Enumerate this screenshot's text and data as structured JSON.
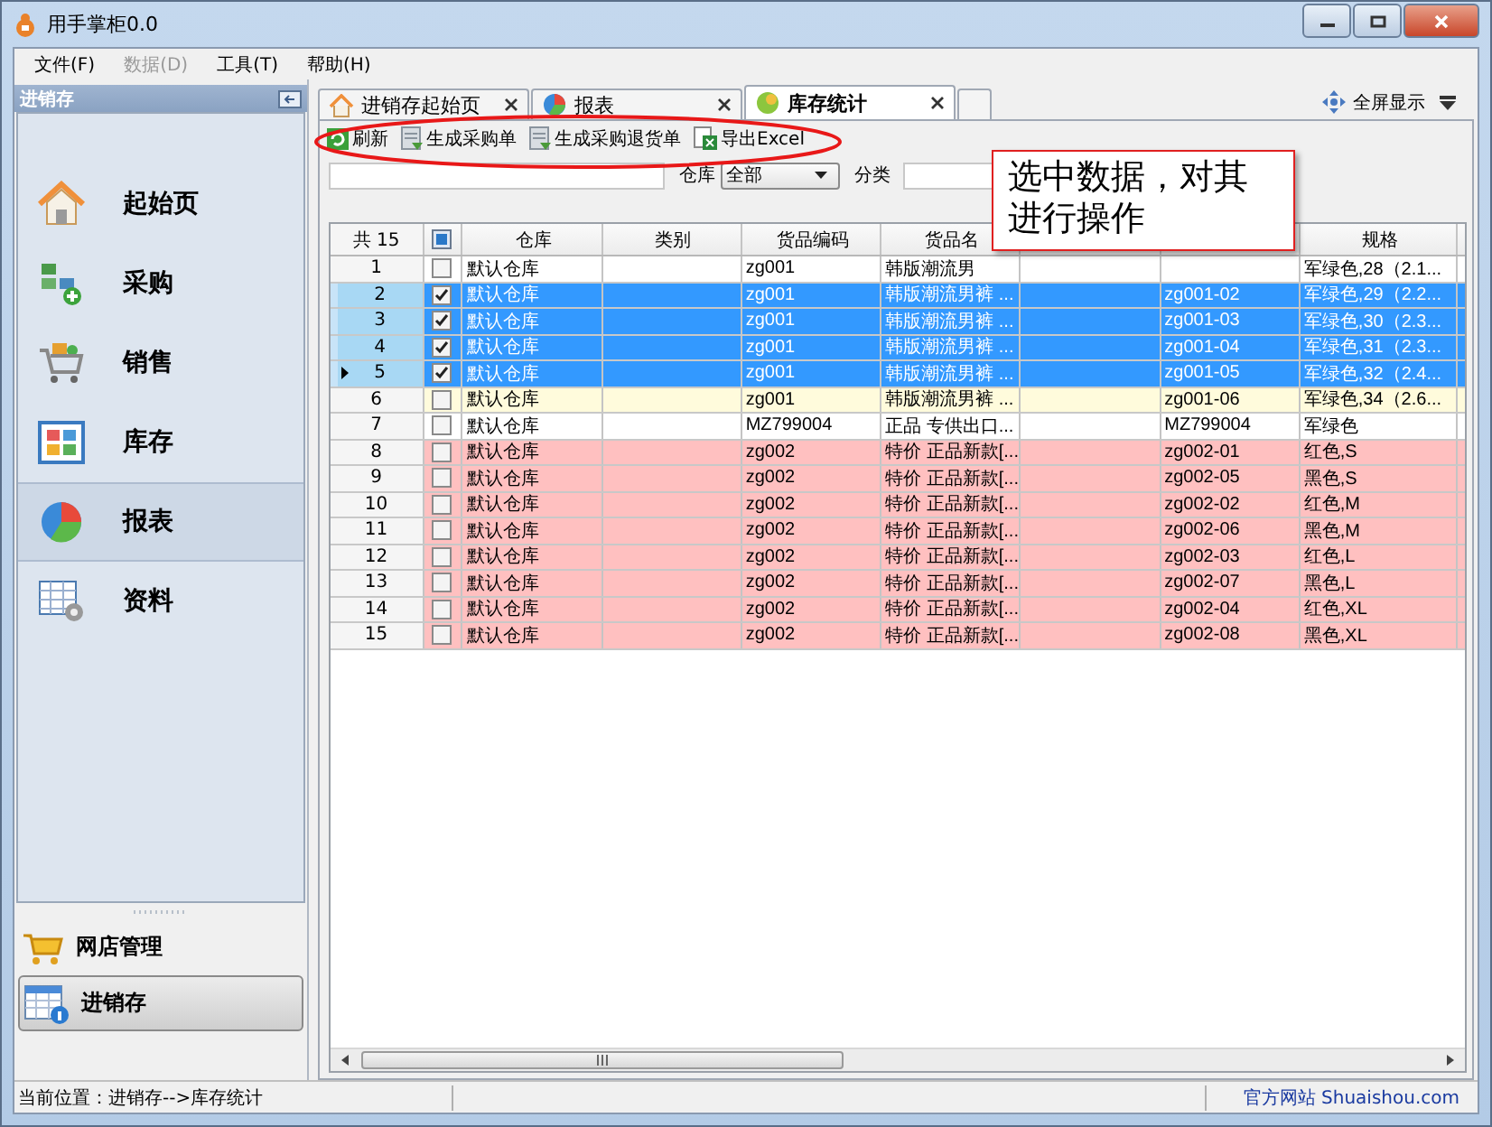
{
  "window": {
    "title": "用手掌柜0.0"
  },
  "menu": [
    {
      "label": "文件(F)",
      "disabled": false
    },
    {
      "label": "数据(D)",
      "disabled": true
    },
    {
      "label": "工具(T)",
      "disabled": false
    },
    {
      "label": "帮助(H)",
      "disabled": false
    }
  ],
  "sidebar": {
    "title": "进销存",
    "items": [
      {
        "label": "起始页",
        "selected": false
      },
      {
        "label": "采购",
        "selected": false
      },
      {
        "label": "销售",
        "selected": false
      },
      {
        "label": "库存",
        "selected": false
      },
      {
        "label": "报表",
        "selected": true
      },
      {
        "label": "资料",
        "selected": false
      }
    ],
    "modules": [
      {
        "label": "网店管理",
        "selected": false
      },
      {
        "label": "进销存",
        "selected": true
      }
    ]
  },
  "tabs": [
    {
      "label": "进销存起始页",
      "selected": false
    },
    {
      "label": "报表",
      "selected": false
    },
    {
      "label": "库存统计",
      "selected": true
    }
  ],
  "fullscreen": "全屏显示",
  "toolbar": [
    "刷新",
    "生成采购单",
    "生成采购退货单",
    "导出Excel"
  ],
  "filter": {
    "warehouse_label": "仓库",
    "warehouse_value": "全部",
    "category_label": "分类"
  },
  "callout": "选中数据，对其进行操作",
  "table": {
    "count": "共 15",
    "select_all_partial": true,
    "columns": [
      "仓库",
      "类别",
      "货品编码",
      "货品名",
      "规格"
    ],
    "rows": [
      {
        "no": "1",
        "checked": false,
        "selected": false,
        "current": false,
        "color": "#ffffff",
        "cells": [
          "默认仓库",
          "",
          "zg001",
          "韩版潮流男",
          "",
          "",
          "军绿色,28（2.1..."
        ]
      },
      {
        "no": "2",
        "checked": true,
        "selected": true,
        "current": false,
        "cells": [
          "默认仓库",
          "",
          "zg001",
          "韩版潮流男裤 ...",
          "",
          "zg001-02",
          "军绿色,29（2.2..."
        ]
      },
      {
        "no": "3",
        "checked": true,
        "selected": true,
        "current": false,
        "cells": [
          "默认仓库",
          "",
          "zg001",
          "韩版潮流男裤 ...",
          "",
          "zg001-03",
          "军绿色,30（2.3..."
        ]
      },
      {
        "no": "4",
        "checked": true,
        "selected": true,
        "current": false,
        "cells": [
          "默认仓库",
          "",
          "zg001",
          "韩版潮流男裤 ...",
          "",
          "zg001-04",
          "军绿色,31（2.3..."
        ]
      },
      {
        "no": "5",
        "checked": true,
        "selected": true,
        "current": true,
        "cells": [
          "默认仓库",
          "",
          "zg001",
          "韩版潮流男裤 ...",
          "",
          "zg001-05",
          "军绿色,32（2.4..."
        ]
      },
      {
        "no": "6",
        "checked": false,
        "selected": false,
        "current": false,
        "color": "#fffbdc",
        "cells": [
          "默认仓库",
          "",
          "zg001",
          "韩版潮流男裤 ...",
          "",
          "zg001-06",
          "军绿色,34（2.6..."
        ]
      },
      {
        "no": "7",
        "checked": false,
        "selected": false,
        "current": false,
        "color": "#ffffff",
        "cells": [
          "默认仓库",
          "",
          "MZ799004",
          "正品 专供出口...",
          "",
          "MZ799004",
          "军绿色"
        ]
      },
      {
        "no": "8",
        "checked": false,
        "selected": false,
        "current": false,
        "color": "#ffc0c0",
        "cells": [
          "默认仓库",
          "",
          "zg002",
          "特价 正品新款[...",
          "",
          "zg002-01",
          "红色,S"
        ]
      },
      {
        "no": "9",
        "checked": false,
        "selected": false,
        "current": false,
        "color": "#ffc0c0",
        "cells": [
          "默认仓库",
          "",
          "zg002",
          "特价 正品新款[...",
          "",
          "zg002-05",
          "黑色,S"
        ]
      },
      {
        "no": "10",
        "checked": false,
        "selected": false,
        "current": false,
        "color": "#ffc0c0",
        "cells": [
          "默认仓库",
          "",
          "zg002",
          "特价 正品新款[...",
          "",
          "zg002-02",
          "红色,M"
        ]
      },
      {
        "no": "11",
        "checked": false,
        "selected": false,
        "current": false,
        "color": "#ffc0c0",
        "cells": [
          "默认仓库",
          "",
          "zg002",
          "特价 正品新款[...",
          "",
          "zg002-06",
          "黑色,M"
        ]
      },
      {
        "no": "12",
        "checked": false,
        "selected": false,
        "current": false,
        "color": "#ffc0c0",
        "cells": [
          "默认仓库",
          "",
          "zg002",
          "特价 正品新款[...",
          "",
          "zg002-03",
          "红色,L"
        ]
      },
      {
        "no": "13",
        "checked": false,
        "selected": false,
        "current": false,
        "color": "#ffc0c0",
        "cells": [
          "默认仓库",
          "",
          "zg002",
          "特价 正品新款[...",
          "",
          "zg002-07",
          "黑色,L"
        ]
      },
      {
        "no": "14",
        "checked": false,
        "selected": false,
        "current": false,
        "color": "#ffc0c0",
        "cells": [
          "默认仓库",
          "",
          "zg002",
          "特价 正品新款[...",
          "",
          "zg002-04",
          "红色,XL"
        ]
      },
      {
        "no": "15",
        "checked": false,
        "selected": false,
        "current": false,
        "color": "#ffc0c0",
        "cells": [
          "默认仓库",
          "",
          "zg002",
          "特价 正品新款[...",
          "",
          "zg002-08",
          "黑色,XL"
        ]
      }
    ]
  },
  "status_bar": {
    "location": "当前位置：进销存-->库存统计",
    "link": "官方网站 Shuaishou.com"
  }
}
